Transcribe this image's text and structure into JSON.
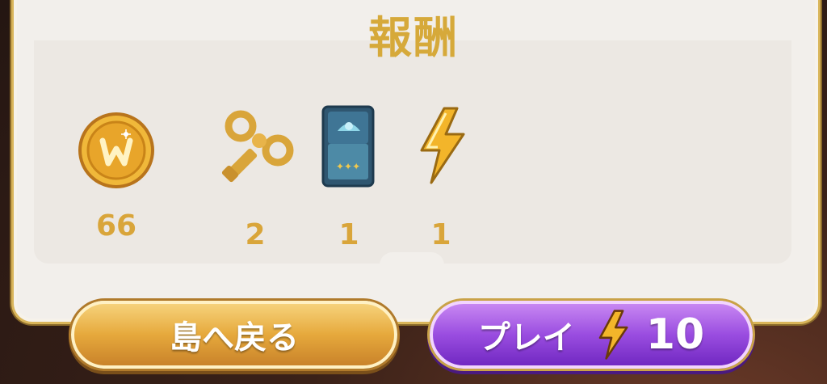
{
  "header": {
    "title": "報酬"
  },
  "rewards": [
    {
      "icon": "gold-coin-icon",
      "count": "66"
    },
    {
      "icon": "wind-up-key-icon",
      "count": "2"
    },
    {
      "icon": "blue-card-pack-icon",
      "count": "1"
    },
    {
      "icon": "lightning-bolt-icon",
      "count": "1"
    }
  ],
  "buttons": {
    "back_label": "島へ戻る",
    "play_label": "プレイ",
    "play_cost": "10",
    "play_cost_icon": "lightning-bolt-icon"
  },
  "colors": {
    "gold": "#d6a93a",
    "panel": "#f2efeb",
    "back_button": "#e6a93c",
    "play_button": "#9a4de0"
  }
}
